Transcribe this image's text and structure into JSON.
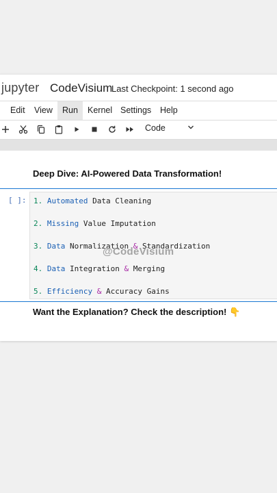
{
  "header": {
    "logo_text": "jupyter",
    "notebook_title": "CodeVisium",
    "checkpoint": "Last Checkpoint: 1 second ago"
  },
  "menubar": {
    "items": [
      {
        "label": "Edit"
      },
      {
        "label": "View"
      },
      {
        "label": "Run"
      },
      {
        "label": "Kernel"
      },
      {
        "label": "Settings"
      },
      {
        "label": "Help"
      }
    ],
    "active": "Run"
  },
  "toolbar": {
    "buttons": [
      "add-cell-icon",
      "cut-icon",
      "copy-icon",
      "paste-icon",
      "run-icon",
      "stop-icon",
      "restart-icon",
      "fast-forward-icon"
    ],
    "cell_type": "Code"
  },
  "notebook": {
    "heading": "Deep Dive: AI-Powered Data Transformation!",
    "prompt": "[ ]:",
    "code_lines": [
      {
        "num": "1.",
        "kw": "Automated",
        "rest": " Data Cleaning"
      },
      {
        "num": "2.",
        "kw": "Missing",
        "rest": " Value Imputation"
      },
      {
        "num": "3.",
        "kw": "Data",
        "rest1": " Normalization ",
        "op": "&",
        "rest2": " Standardization"
      },
      {
        "num": "4.",
        "kw": "Data",
        "rest1": " Integration ",
        "op": "&",
        "rest2": " Merging"
      },
      {
        "num": "5.",
        "kw": "Efficiency",
        "rest1": " ",
        "op": "&",
        "rest2": " Accuracy Gains"
      }
    ],
    "watermark": "@CodeVisium",
    "footer": "Want the Explanation? Check the description! 👇"
  },
  "colors": {
    "accent": "#1976d2",
    "number": "#098658",
    "keyword": "#1a5fb4",
    "operator": "#a626a4"
  }
}
